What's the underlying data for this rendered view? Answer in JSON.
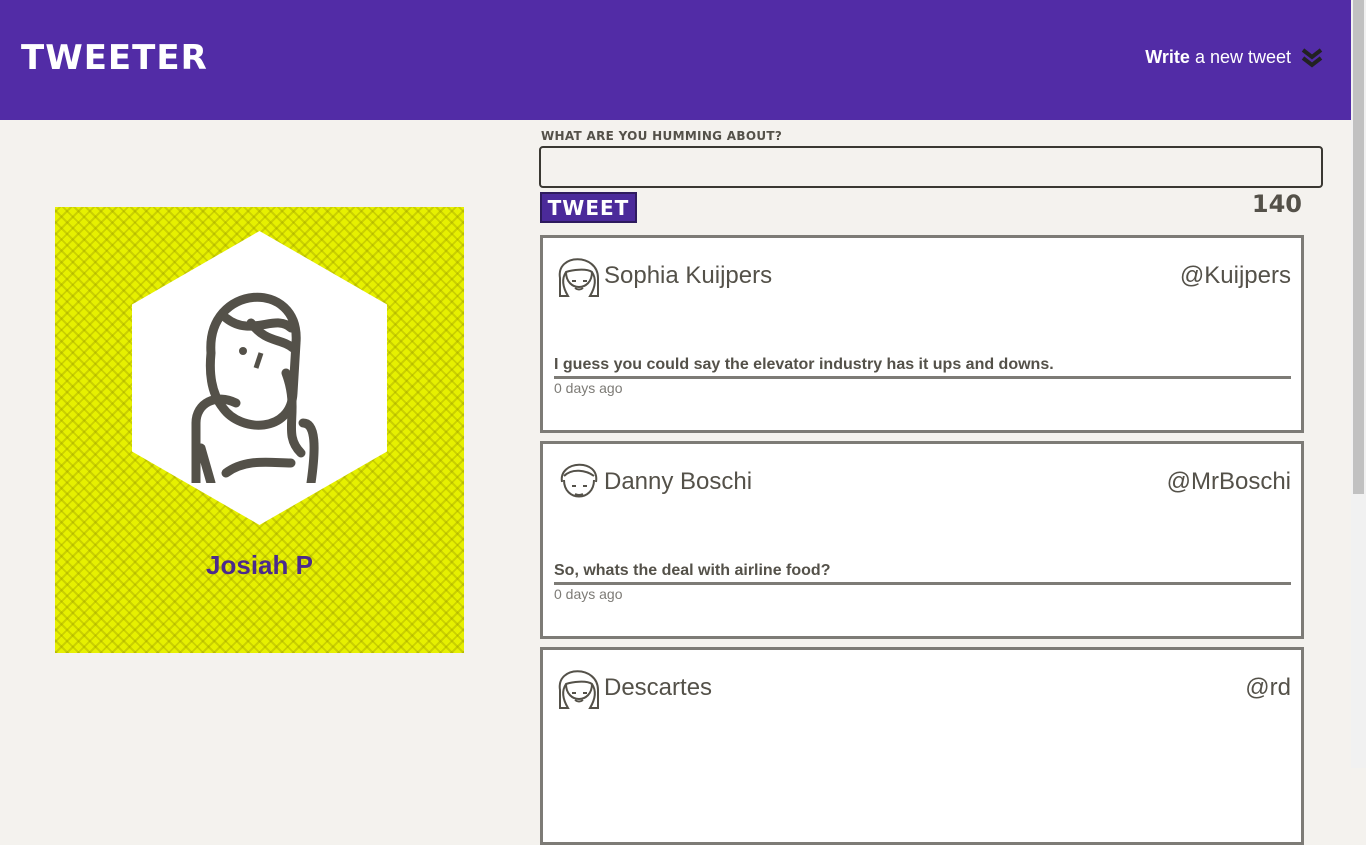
{
  "nav": {
    "logo": "TWEETER",
    "compose_bold": "Write",
    "compose_rest": "a new tweet"
  },
  "profile": {
    "name": "Josiah P"
  },
  "compose": {
    "label": "What are you humming about?",
    "input_value": "",
    "button_label": "Tweet",
    "counter": "140"
  },
  "tweets": [
    {
      "name": "Sophia Kuijpers",
      "handle": "@Kuijpers",
      "body": "I guess you could say the elevator industry has it ups and downs.",
      "time": "0 days ago"
    },
    {
      "name": "Danny Boschi",
      "handle": "@MrBoschi",
      "body": "So, whats the deal with airline food?",
      "time": "0 days ago"
    },
    {
      "name": "Descartes",
      "handle": "@rd"
    }
  ],
  "colors": {
    "brand": "#522ca6",
    "profile_bg": "#e6f000",
    "text": "#545149"
  }
}
